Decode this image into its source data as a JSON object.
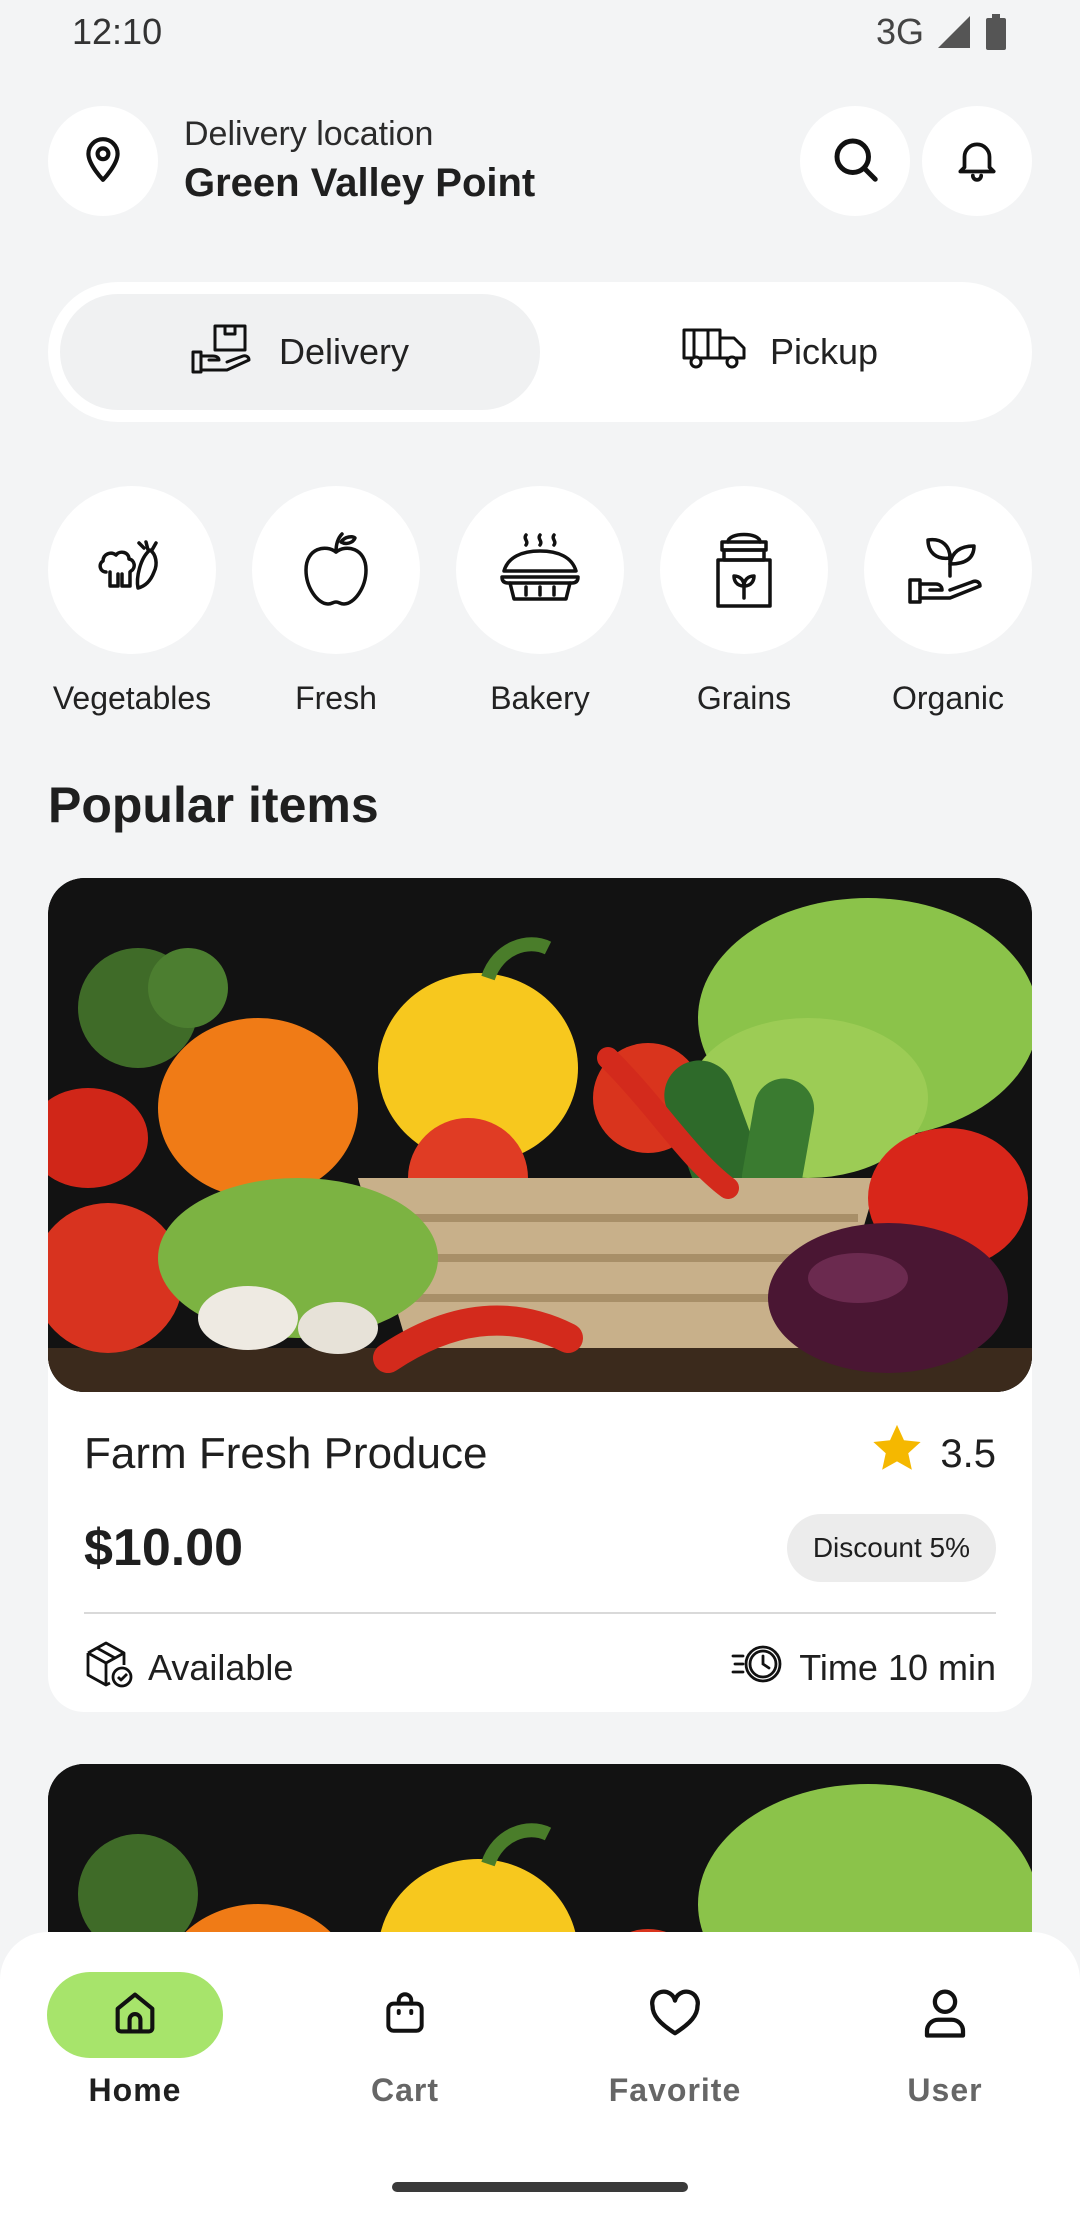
{
  "status_bar": {
    "time": "12:10",
    "network": "3G",
    "icons": [
      "signal-icon",
      "battery-icon"
    ]
  },
  "header": {
    "location_label": "Delivery location",
    "location_name": "Green Valley Point",
    "icons": [
      "location-pin-icon",
      "search-icon",
      "bell-icon"
    ]
  },
  "mode_toggle": {
    "options": [
      {
        "label": "Delivery",
        "icon": "box-hand-icon",
        "active": true
      },
      {
        "label": "Pickup",
        "icon": "truck-icon",
        "active": false
      }
    ]
  },
  "categories": [
    {
      "label": "Vegetables",
      "icon": "vegetables-icon"
    },
    {
      "label": "Fresh",
      "icon": "apple-icon"
    },
    {
      "label": "Bakery",
      "icon": "pie-icon"
    },
    {
      "label": "Grains",
      "icon": "grain-sack-icon"
    },
    {
      "label": "Organic",
      "icon": "sprout-hand-icon"
    }
  ],
  "popular": {
    "title": "Popular items",
    "items": [
      {
        "name": "Farm Fresh Produce",
        "rating": "3.5",
        "price": "$10.00",
        "discount": "Discount 5%",
        "availability": "Available",
        "time": "Time 10 min"
      }
    ]
  },
  "bottom_nav": {
    "items": [
      {
        "label": "Home",
        "icon": "home-icon",
        "active": true
      },
      {
        "label": "Cart",
        "icon": "bag-icon",
        "active": false
      },
      {
        "label": "Favorite",
        "icon": "heart-icon",
        "active": false
      },
      {
        "label": "User",
        "icon": "user-icon",
        "active": false
      }
    ]
  },
  "colors": {
    "accent": "#a7e46b",
    "background": "#f3f4f5",
    "star": "#f5b800"
  }
}
